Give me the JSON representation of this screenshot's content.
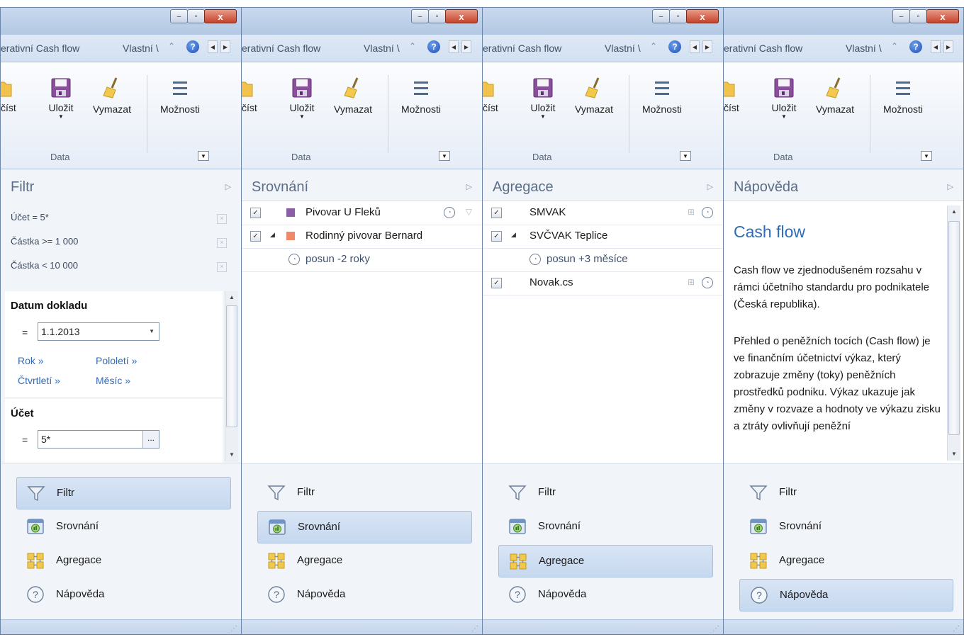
{
  "windows": [
    {
      "caption": {
        "minimize": "–",
        "maximize": "▫",
        "close": "x"
      },
      "tab_text": "erativní Cash flow",
      "tab_custom": "Vlastní \\",
      "help_glyph": "?",
      "ribbon": {
        "open": "číst",
        "save": "Uložit",
        "clear": "Vymazat",
        "options": "Možnosti",
        "group": "Data"
      },
      "panel_title": "Filtr",
      "filters": [
        "Účet = 5*",
        "Částka >= 1 000",
        "Částka < 10 000"
      ],
      "date_group": {
        "title": "Datum dokladu",
        "op": "=",
        "value": "1.1.2013",
        "links": [
          "Rok »",
          "Pololetí »",
          "Čtvrtletí »",
          "Měsíc »"
        ]
      },
      "account_group": {
        "title": "Účet",
        "op": "=",
        "value": "5*",
        "btn": "..."
      }
    },
    {
      "tab_text": "erativní Cash flow",
      "tab_custom": "Vlastní \\",
      "ribbon": {
        "open": "číst",
        "save": "Uložit",
        "clear": "Vymazat",
        "options": "Možnosti",
        "group": "Data"
      },
      "panel_title": "Srovnání",
      "rows": [
        {
          "label": "Pivovar U Fleků",
          "color": "#8a5fa8"
        },
        {
          "label": "Rodinný pivovar Bernard",
          "color": "#ee8a6a"
        },
        {
          "label": "posun -2 roky"
        }
      ]
    },
    {
      "tab_text": "erativní Cash flow",
      "tab_custom": "Vlastní \\",
      "ribbon": {
        "open": "číst",
        "save": "Uložit",
        "clear": "Vymazat",
        "options": "Možnosti",
        "group": "Data"
      },
      "panel_title": "Agregace",
      "rows": [
        {
          "label": "SMVAK"
        },
        {
          "label": "SVČVAK Teplice"
        },
        {
          "label": "posun +3 měsíce"
        },
        {
          "label": "Novak.cs"
        }
      ]
    },
    {
      "tab_text": "erativní Cash flow",
      "tab_custom": "Vlastní \\",
      "ribbon": {
        "open": "číst",
        "save": "Uložit",
        "clear": "Vymazat",
        "options": "Možnosti",
        "group": "Data"
      },
      "panel_title": "Nápověda",
      "help_heading": "Cash flow",
      "help_p1": "Cash flow ve zjednodušeném rozsahu v rámci účetního standardu pro podnikatele (Česká republika).",
      "help_p2": "Přehled o peněžních tocích (Cash flow) je ve finančním účetnictví výkaz, který zobrazuje změny (toky) peněžních prostředků podniku. Výkaz ukazuje jak změny v rozvaze a hodnoty ve výkazu zisku a ztráty ovlivňují peněžní"
    }
  ],
  "nav": [
    "Filtr",
    "Srovnání",
    "Agregace",
    "Nápověda"
  ],
  "checkbox_mark": "✓",
  "icons": [
    "minimize-icon",
    "maximize-icon",
    "close-icon",
    "help-icon",
    "open-folder-icon",
    "save-disk-icon",
    "broom-icon",
    "options-menu-icon",
    "funnel-icon",
    "compare-icon",
    "aggregate-icon",
    "question-icon",
    "clock-icon",
    "pin-icon"
  ]
}
